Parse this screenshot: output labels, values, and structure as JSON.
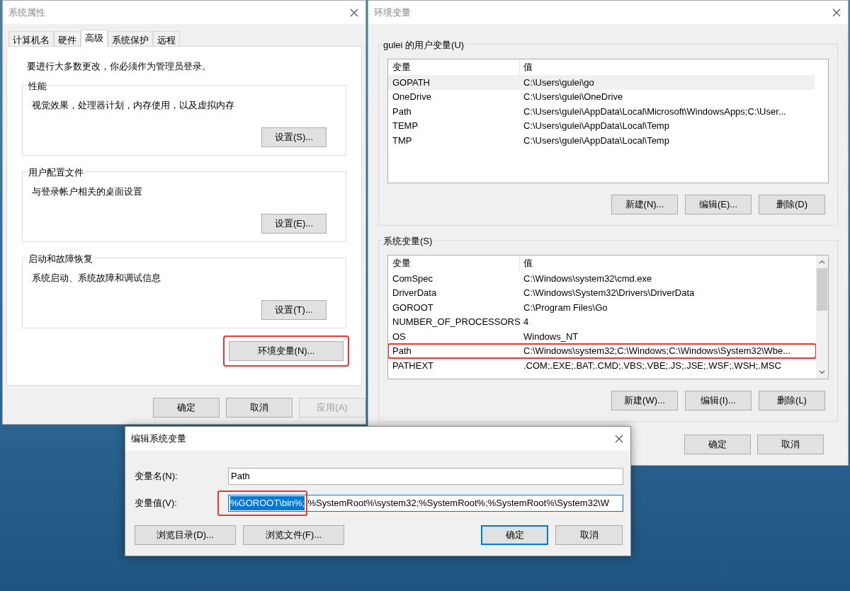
{
  "system_properties": {
    "title": "系统属性",
    "tabs": [
      {
        "label": "计算机名",
        "selected": false
      },
      {
        "label": "硬件",
        "selected": false
      },
      {
        "label": "高级",
        "selected": true
      },
      {
        "label": "系统保护",
        "selected": false
      },
      {
        "label": "远程",
        "selected": false
      }
    ],
    "notice": "要进行大多数更改，你必须作为管理员登录。",
    "groups": [
      {
        "legend": "性能",
        "description": "视觉效果，处理器计划，内存使用，以及虚拟内存",
        "button": "设置(S)..."
      },
      {
        "legend": "用户配置文件",
        "description": "与登录帐户相关的桌面设置",
        "button": "设置(E)..."
      },
      {
        "legend": "启动和故障恢复",
        "description": "系统启动、系统故障和调试信息",
        "button": "设置(T)..."
      }
    ],
    "env_button": {
      "label": "环境变量(N)...",
      "annotated": true
    },
    "buttons": [
      {
        "label": "确定",
        "disabled": false
      },
      {
        "label": "取消",
        "disabled": false
      },
      {
        "label": "应用(A)",
        "disabled": true
      }
    ]
  },
  "environment_variables": {
    "title": "环境变量",
    "user_vars": {
      "legend": "gulei 的用户变量(U)",
      "columns": [
        "变量",
        "值"
      ],
      "rows": [
        {
          "name": "GOPATH",
          "value": "C:\\Users\\gulei\\go",
          "selected": true,
          "annotated": false
        },
        {
          "name": "OneDrive",
          "value": "C:\\Users\\gulei\\OneDrive",
          "selected": false,
          "annotated": false
        },
        {
          "name": "Path",
          "value": "C:\\Users\\gulei\\AppData\\Local\\Microsoft\\WindowsApps;C:\\User...",
          "selected": false,
          "annotated": false
        },
        {
          "name": "TEMP",
          "value": "C:\\Users\\gulei\\AppData\\Local\\Temp",
          "selected": false,
          "annotated": false
        },
        {
          "name": "TMP",
          "value": "C:\\Users\\gulei\\AppData\\Local\\Temp",
          "selected": false,
          "annotated": false
        }
      ],
      "buttons": [
        "新建(N)...",
        "编辑(E)...",
        "删除(D)"
      ]
    },
    "system_vars": {
      "legend": "系统变量(S)",
      "columns": [
        "变量",
        "值"
      ],
      "rows": [
        {
          "name": "ComSpec",
          "value": "C:\\Windows\\system32\\cmd.exe",
          "selected": false,
          "annotated": false
        },
        {
          "name": "DriverData",
          "value": "C:\\Windows\\System32\\Drivers\\DriverData",
          "selected": false,
          "annotated": false
        },
        {
          "name": "GOROOT",
          "value": "C:\\Program Files\\Go",
          "selected": false,
          "annotated": false
        },
        {
          "name": "NUMBER_OF_PROCESSORS",
          "value": "4",
          "selected": false,
          "annotated": false
        },
        {
          "name": "OS",
          "value": "Windows_NT",
          "selected": false,
          "annotated": false
        },
        {
          "name": "Path",
          "value": "C:\\Windows\\system32;C:\\Windows;C:\\Windows\\System32\\Wbe...",
          "selected": false,
          "annotated": true
        },
        {
          "name": "PATHEXT",
          "value": ".COM;.EXE;.BAT;.CMD;.VBS;.VBE;.JS;.JSE;.WSF;.WSH;.MSC",
          "selected": false,
          "annotated": false
        }
      ],
      "buttons": [
        "新建(W)...",
        "编辑(I)...",
        "删除(L)"
      ]
    },
    "buttons": [
      "确定",
      "取消"
    ]
  },
  "edit_dialog": {
    "title": "编辑系统变量",
    "name_label": "变量名(N):",
    "name_value": "Path",
    "value_label": "变量值(V):",
    "value_selected": "%GOROOT\\bin%;",
    "value_rest": "%SystemRoot%\\system32;%SystemRoot%;%SystemRoot%\\System32\\W",
    "value_annotated": true,
    "buttons": [
      {
        "label": "浏览目录(D)...",
        "default": false
      },
      {
        "label": "浏览文件(F)...",
        "default": false
      },
      {
        "label": "确定",
        "default": true
      },
      {
        "label": "取消",
        "default": false
      }
    ]
  }
}
